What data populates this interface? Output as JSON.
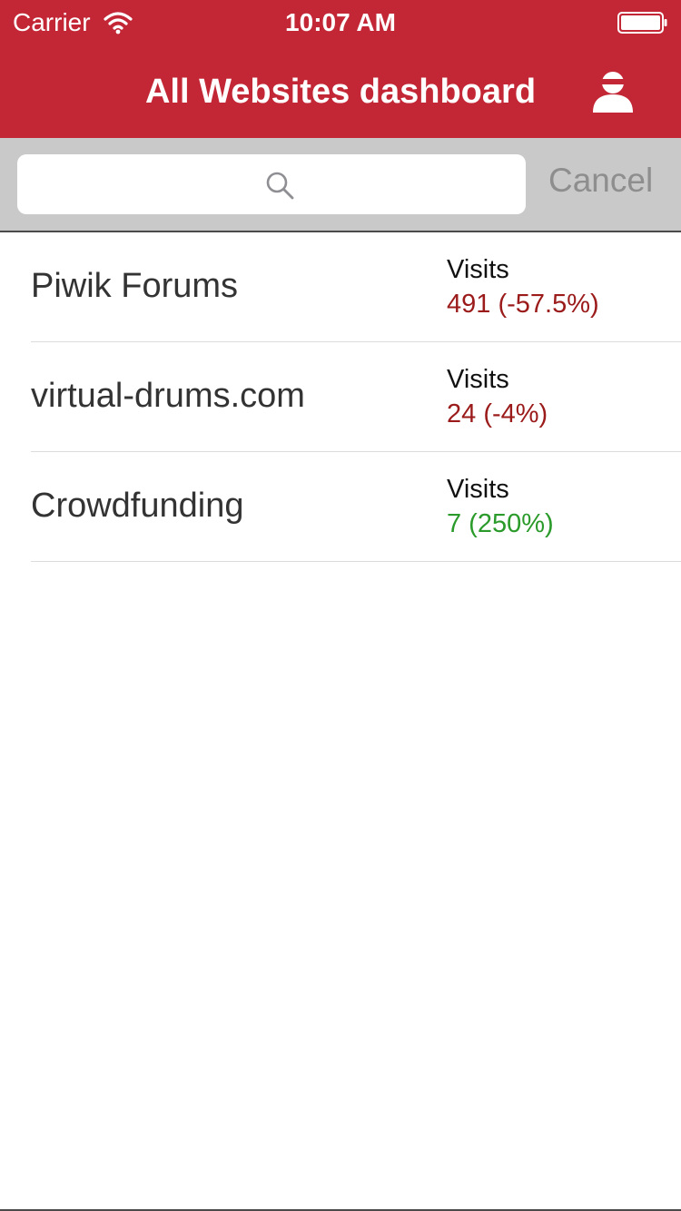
{
  "status_bar": {
    "carrier": "Carrier",
    "time": "10:07 AM"
  },
  "nav": {
    "title": "All Websites dashboard",
    "user_icon": "user-icon"
  },
  "search": {
    "value": "",
    "placeholder": "",
    "icon": "search-icon",
    "cancel_label": "Cancel"
  },
  "sites": [
    {
      "name": "Piwik Forums",
      "metric_label": "Visits",
      "metric_value": "491 (-57.5%)",
      "trend": "down"
    },
    {
      "name": "virtual-drums.com",
      "metric_label": "Visits",
      "metric_value": "24 (-4%)",
      "trend": "down"
    },
    {
      "name": "Crowdfunding",
      "metric_label": "Visits",
      "metric_value": "7 (250%)",
      "trend": "up"
    }
  ],
  "colors": {
    "brand_red": "#c32736",
    "trend_down": "#9b1b1b",
    "trend_up": "#2a9a2a"
  }
}
